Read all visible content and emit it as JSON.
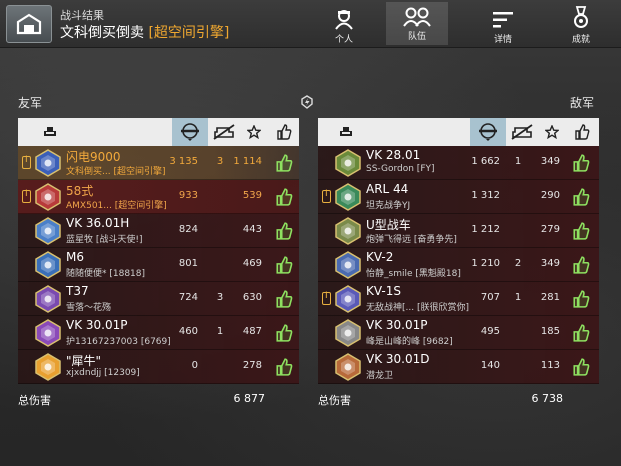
{
  "header": {
    "subtitle": "战斗结果",
    "title": "文科倒买倒卖",
    "mode": "[超空间引擎]",
    "tabs": [
      {
        "label": "个人",
        "icon": "soldier-icon"
      },
      {
        "label": "队伍",
        "icon": "team-icon"
      },
      {
        "label": "详情",
        "icon": "list-icon"
      },
      {
        "label": "成就",
        "icon": "medal-icon"
      }
    ],
    "active_tab": "队伍"
  },
  "allies": {
    "label": "友军",
    "total_label": "总伤害",
    "total_value": "6 877",
    "rows": [
      {
        "tank": "闪电9000",
        "player": "文科倒买... [超空间引擎]",
        "damage": "3 135",
        "kills": "3",
        "assist": "1 114",
        "platoon": true,
        "style": "highlight",
        "badge_color": "#3b5fb8"
      },
      {
        "tank": "58式",
        "player": "AMX501... [超空间引擎]",
        "damage": "933",
        "kills": "",
        "assist": "539",
        "platoon": true,
        "style": "player",
        "badge_color": "#b83a3a"
      },
      {
        "tank": "VK 36.01H",
        "player": "蓝星牧 [战斗天使!]",
        "damage": "824",
        "kills": "",
        "assist": "443",
        "platoon": false,
        "style": "",
        "badge_color": "#4a7fc8"
      },
      {
        "tank": "M6",
        "player": "随随便便* [18818]",
        "damage": "801",
        "kills": "",
        "assist": "469",
        "platoon": false,
        "style": "",
        "badge_color": "#3a6fb8"
      },
      {
        "tank": "T37",
        "player": "雪落～花殇",
        "damage": "724",
        "kills": "3",
        "assist": "630",
        "platoon": false,
        "style": "",
        "badge_color": "#7a4ab0"
      },
      {
        "tank": "VK 30.01P",
        "player": "护13167237003 [6769]",
        "damage": "460",
        "kills": "1",
        "assist": "487",
        "platoon": false,
        "style": "",
        "badge_color": "#8a4ab8"
      },
      {
        "tank": "\"犀牛\"",
        "player": "xjxdndjj [12309]",
        "damage": "0",
        "kills": "",
        "assist": "278",
        "platoon": false,
        "style": "",
        "badge_color": "#e8a030"
      }
    ]
  },
  "enemies": {
    "label": "敌军",
    "total_label": "总伤害",
    "total_value": "6 738",
    "rows": [
      {
        "tank": "VK 28.01",
        "player": "SS-Gordon [FY]",
        "damage": "1 662",
        "kills": "1",
        "assist": "349",
        "platoon": false,
        "badge_color": "#6a8a3a"
      },
      {
        "tank": "ARL 44",
        "player": "坦克战争YJ",
        "damage": "1 312",
        "kills": "",
        "assist": "290",
        "platoon": true,
        "badge_color": "#3a8a5a"
      },
      {
        "tank": "U型战车",
        "player": "炮弹飞得远 [奋勇争先]",
        "damage": "1 212",
        "kills": "",
        "assist": "279",
        "platoon": false,
        "badge_color": "#7a8a4a"
      },
      {
        "tank": "KV-2",
        "player": "怡静_smile [黑魁殿18]",
        "damage": "1 210",
        "kills": "2",
        "assist": "349",
        "platoon": false,
        "badge_color": "#4a6ab0"
      },
      {
        "tank": "KV-1S",
        "player": "无敌战神[... [朕很欣赏你]",
        "damage": "707",
        "kills": "1",
        "assist": "281",
        "platoon": true,
        "badge_color": "#5a5ab8"
      },
      {
        "tank": "VK 30.01P",
        "player": "峰是山峰的峰 [9682]",
        "damage": "495",
        "kills": "",
        "assist": "185",
        "platoon": false,
        "badge_color": "#888"
      },
      {
        "tank": "VK 30.01D",
        "player": "潜龙卫",
        "damage": "140",
        "kills": "",
        "assist": "113",
        "platoon": false,
        "badge_color": "#b86a3a"
      }
    ]
  },
  "columns": [
    {
      "name": "vehicle",
      "icon": "tank-icon"
    },
    {
      "name": "damage",
      "icon": "damage-icon"
    },
    {
      "name": "kills",
      "icon": "destroyed-icon"
    },
    {
      "name": "assist",
      "icon": "star-icon"
    },
    {
      "name": "like",
      "icon": "thumbs-up-icon"
    }
  ]
}
